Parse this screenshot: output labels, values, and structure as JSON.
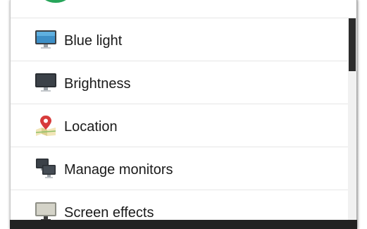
{
  "menu": {
    "items": [
      {
        "label": "Blue light",
        "icon": "monitor-blue-icon"
      },
      {
        "label": "Brightness",
        "icon": "monitor-dark-icon"
      },
      {
        "label": "Location",
        "icon": "location-pin-map-icon"
      },
      {
        "label": "Manage monitors",
        "icon": "multiple-monitors-icon"
      },
      {
        "label": "Screen effects",
        "icon": "monitor-gray-icon"
      }
    ]
  },
  "colors": {
    "top_avatar": "#27a55a",
    "scroll_thumb": "#2b2b2b",
    "bottom_bar": "#222222",
    "label_text": "#1a1a1a"
  }
}
